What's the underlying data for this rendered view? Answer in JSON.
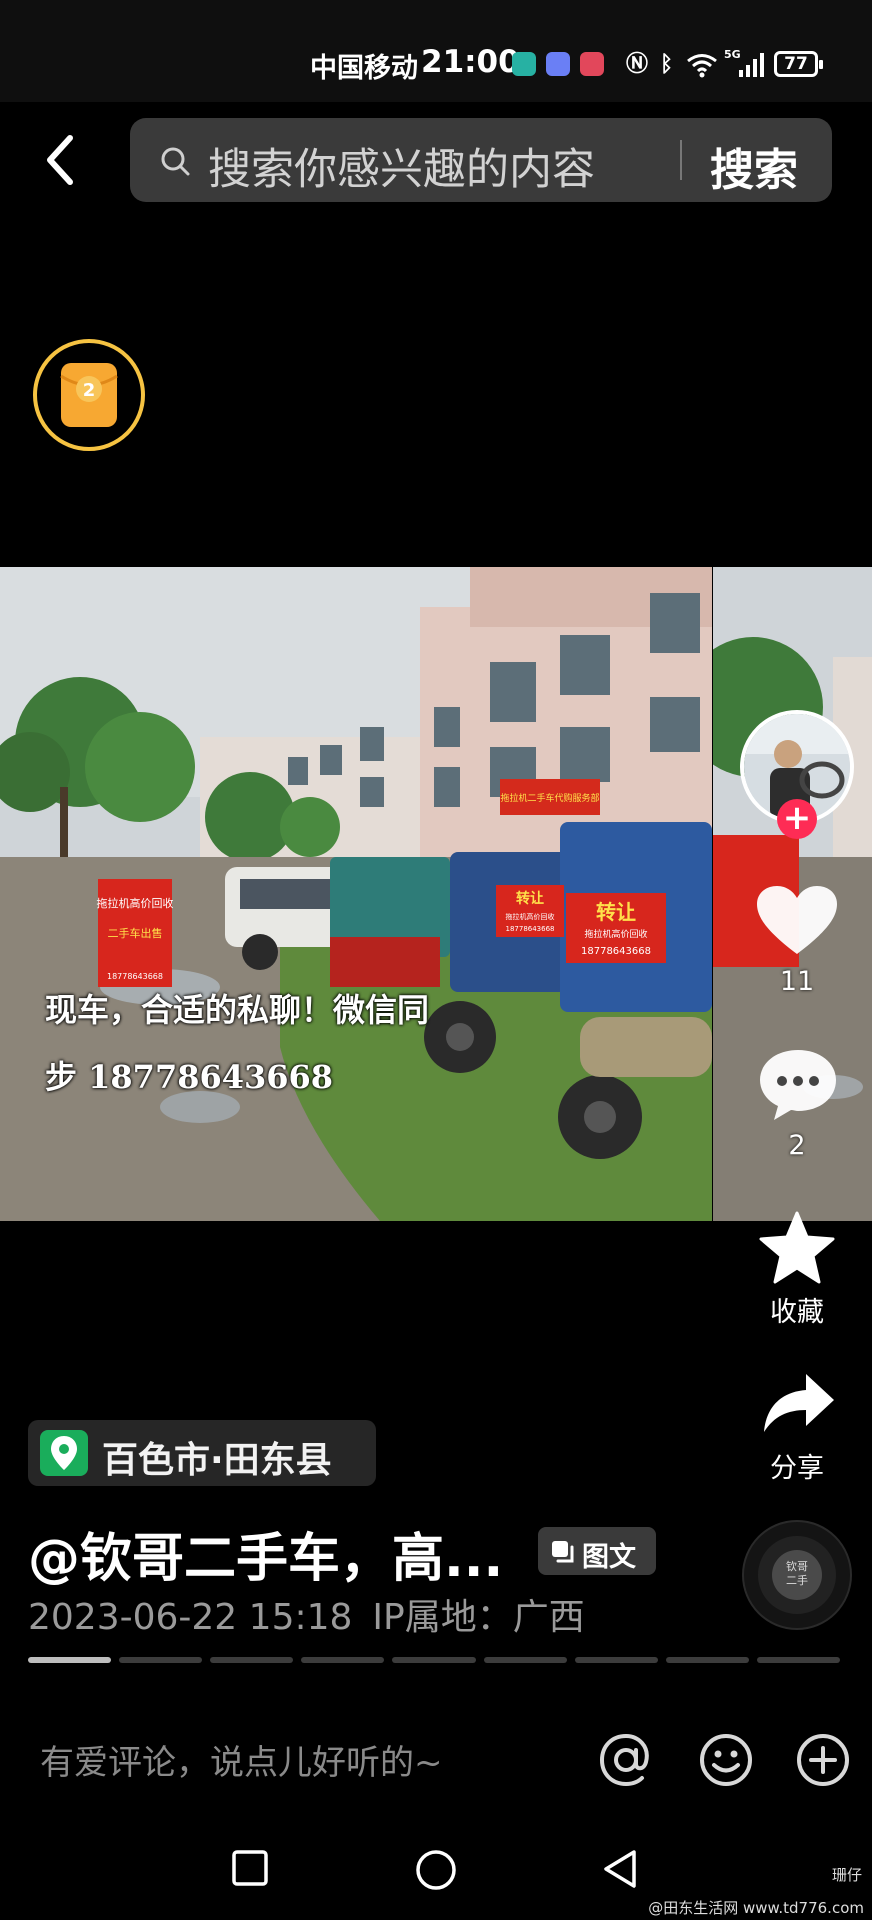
{
  "status_bar": {
    "carrier": "中国移动",
    "time": "21:00",
    "network": "5G",
    "battery": "77"
  },
  "search": {
    "placeholder": "搜索你感兴趣的内容",
    "button_label": "搜索"
  },
  "red_packet": {
    "count": "2"
  },
  "post": {
    "caption_line1": "现车，合适的私聊！微信同",
    "caption_line2": "步 18778643668",
    "location": "百色市·田东县",
    "title": "@钦哥二手车，高...",
    "type_tag": "图文",
    "date": "2023-06-22 15:18",
    "ip_location": "IP属地：广西",
    "image_count": 9,
    "current_image": 1
  },
  "photo_signs": {
    "shop_sign": "拖拉机二手车代购服务部",
    "sign_left": "拖拉机高价回收",
    "sign_left2": "二手车出售",
    "sign_left_phone": "18778643668",
    "sign_mid": "转让",
    "sign_mid_sub": "拖拉机高价回收",
    "sign_mid_phone": "18778643668",
    "sign_big": "转让",
    "sign_big_sub": "拖拉机高价回收",
    "sign_big_phone": "18778643668"
  },
  "actions": {
    "like_count": "11",
    "comment_count": "2",
    "favorite_label": "收藏",
    "share_label": "分享"
  },
  "music": {
    "label": "钦哥\n二手"
  },
  "comment_bar": {
    "placeholder": "有爱评论，说点儿好听的~"
  },
  "watermark": {
    "line1": "珊仔",
    "line2": "@田东生活网 www.td776.com"
  }
}
